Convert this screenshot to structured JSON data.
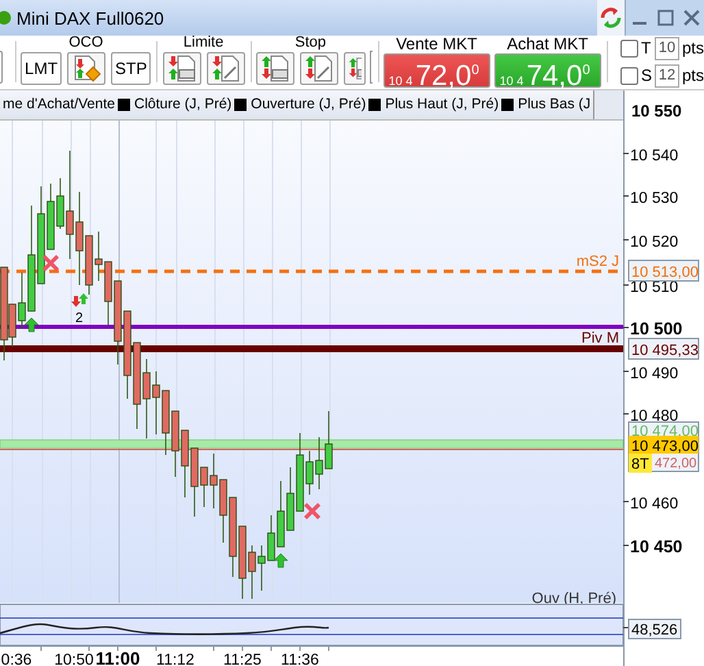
{
  "window": {
    "title": "Mini DAX Full0620"
  },
  "toolbar": {
    "groups": [
      {
        "title": "OCO",
        "buttons": [
          {
            "kind": "text",
            "label": "LMT"
          },
          {
            "kind": "oco"
          },
          {
            "kind": "text",
            "label": "STP"
          }
        ]
      },
      {
        "title": "Limite",
        "buttons": [
          {
            "kind": "limit"
          },
          {
            "kind": "limit-edit"
          }
        ]
      },
      {
        "title": "Stop",
        "buttons": [
          {
            "kind": "stop"
          },
          {
            "kind": "stop-edit"
          },
          {
            "kind": "stop-cut"
          }
        ]
      }
    ]
  },
  "quotes": [
    {
      "kind": "sell",
      "label": "Vente MKT",
      "prefix": "10 4",
      "price": "72,0$^{0}$"
    },
    {
      "kind": "buy",
      "label": "Achat MKT",
      "prefix": "10 4",
      "price": "74,0$^{0}$"
    }
  ],
  "offsets": [
    {
      "label": "T",
      "value": "10",
      "unit": "pts",
      "checked": false
    },
    {
      "label": "S",
      "value": "12",
      "unit": "pts",
      "checked": false
    }
  ],
  "legend": [
    {
      "label": "me d'Achat/Vente",
      "swatch": false
    },
    {
      "label": "Clôture (J, Pré)",
      "swatch": true
    },
    {
      "label": "Ouverture (J, Pré)",
      "swatch": true
    },
    {
      "label": "Plus Haut (J, Pré)",
      "swatch": true
    },
    {
      "label": "Plus Bas (J",
      "swatch": true
    }
  ],
  "price_axis": [
    {
      "label": "10 550",
      "major": true
    },
    {
      "label": "10 540",
      "major": false
    },
    {
      "label": "10 530",
      "major": false
    },
    {
      "label": "10 520",
      "major": false
    },
    {
      "label": "10 510",
      "major": false
    },
    {
      "label": "10 500",
      "major": true
    },
    {
      "label": "10 490",
      "major": false
    },
    {
      "label": "10 480",
      "major": false
    },
    {
      "label": "10 460",
      "major": false
    },
    {
      "label": "10 450",
      "major": true
    }
  ],
  "price_tags": [
    {
      "kind": "ms2",
      "text": "10 513,00"
    },
    {
      "kind": "pivot",
      "text": "10 495,33"
    },
    {
      "kind": "ask",
      "text": "10 474,00"
    },
    {
      "kind": "last",
      "text": "10 473,00"
    },
    {
      "kind": "countdown",
      "text": "8T"
    },
    {
      "kind": "bid",
      "text": "472,00"
    }
  ],
  "line_labels": [
    {
      "kind": "ms2",
      "text": "mS2 J"
    },
    {
      "kind": "pivot",
      "text": "Piv M"
    },
    {
      "kind": "open",
      "text": "Ouv (H, Pré)"
    }
  ],
  "annotations": [
    {
      "kind": "count",
      "text": "2"
    }
  ],
  "oscillator": {
    "value": "48,526"
  },
  "time_axis": [
    {
      "label": "0:36",
      "major": false
    },
    {
      "label": "10:50",
      "major": false
    },
    {
      "label": "11:00",
      "major": true
    },
    {
      "label": "11:12",
      "major": false
    },
    {
      "label": "11:25",
      "major": false
    },
    {
      "label": "11:36",
      "major": false
    }
  ]
}
